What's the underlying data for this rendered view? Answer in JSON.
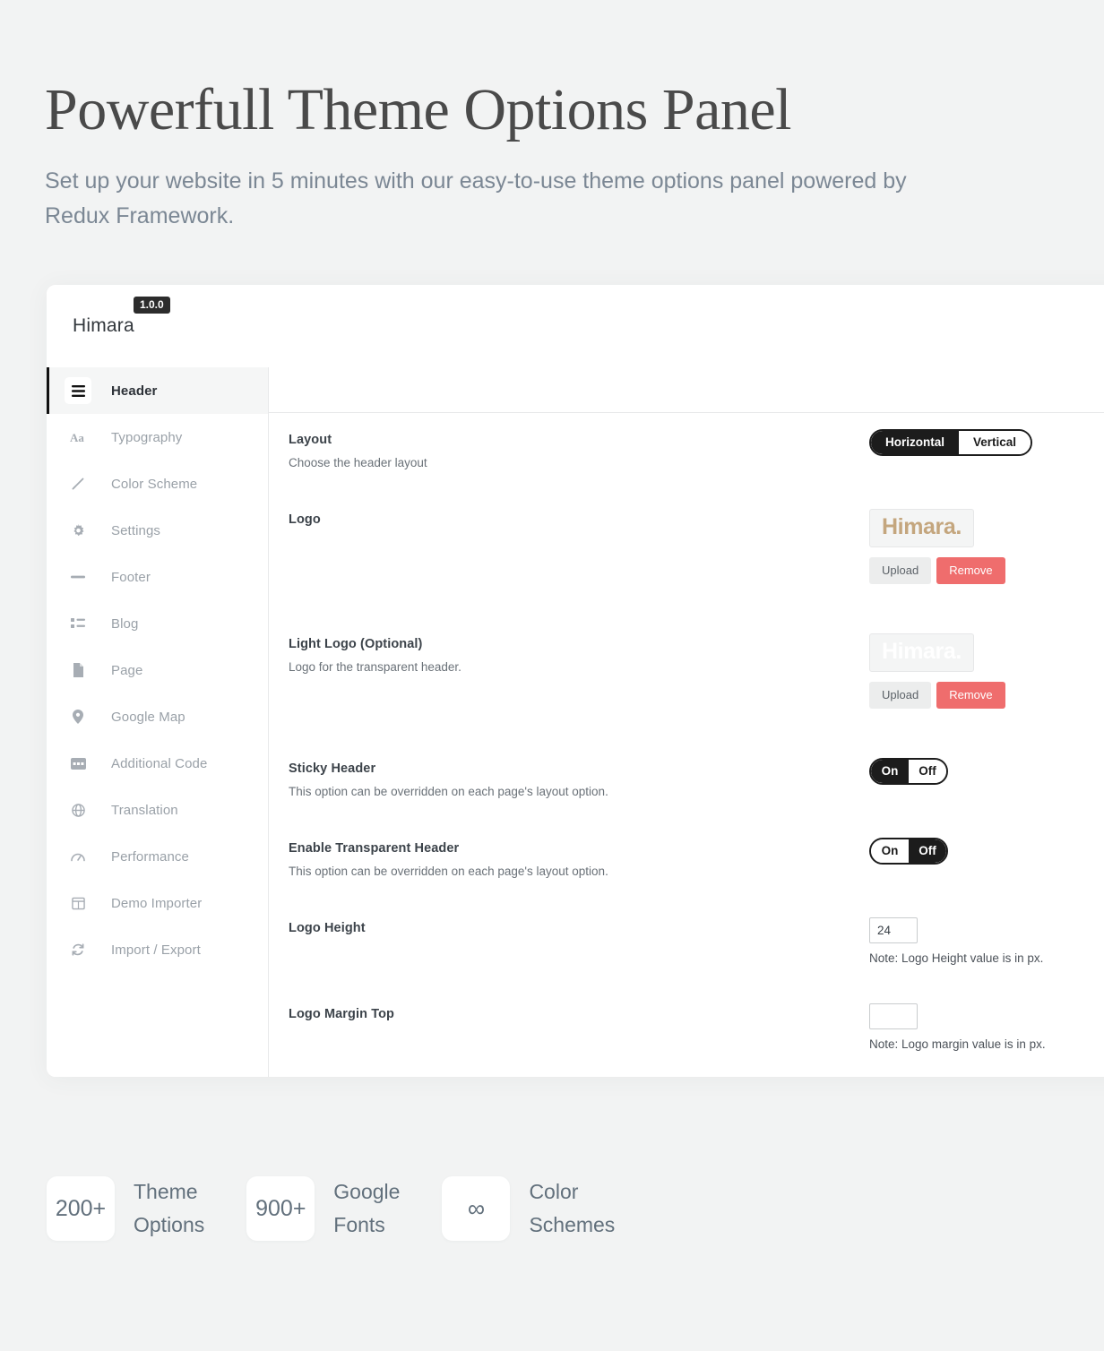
{
  "hero": {
    "title": "Powerfull Theme Options Panel",
    "subtitle": "Set up your website in 5 minutes with our easy-to-use theme options panel powered by Redux Framework."
  },
  "panel": {
    "brand": "Himara",
    "version": "1.0.0"
  },
  "sidebar": {
    "items": [
      {
        "label": "Header",
        "icon": "hamburger-icon",
        "active": true
      },
      {
        "label": "Typography",
        "icon": "text-size-icon",
        "active": false
      },
      {
        "label": "Color Scheme",
        "icon": "brush-icon",
        "active": false
      },
      {
        "label": "Settings",
        "icon": "gear-icon",
        "active": false
      },
      {
        "label": "Footer",
        "icon": "dash-icon",
        "active": false
      },
      {
        "label": "Blog",
        "icon": "list-icon",
        "active": false
      },
      {
        "label": "Page",
        "icon": "file-icon",
        "active": false
      },
      {
        "label": "Google Map",
        "icon": "map-pin-icon",
        "active": false
      },
      {
        "label": "Additional Code",
        "icon": "code-icon",
        "active": false
      },
      {
        "label": "Translation",
        "icon": "globe-icon",
        "active": false
      },
      {
        "label": "Performance",
        "icon": "gauge-icon",
        "active": false
      },
      {
        "label": "Demo Importer",
        "icon": "window-icon",
        "active": false
      },
      {
        "label": "Import / Export",
        "icon": "refresh-icon",
        "active": false
      }
    ]
  },
  "fields": {
    "layout": {
      "label": "Layout",
      "desc": "Choose the header layout",
      "options": [
        "Horizontal",
        "Vertical"
      ],
      "selected": "Horizontal"
    },
    "logo": {
      "label": "Logo",
      "preview_text": "Himara.",
      "preview_color": "#c4a67e",
      "upload_label": "Upload",
      "remove_label": "Remove"
    },
    "light_logo": {
      "label": "Light Logo (Optional)",
      "desc": "Logo for the transparent header.",
      "preview_text": "Himara.",
      "preview_color": "#ffffff",
      "upload_label": "Upload",
      "remove_label": "Remove"
    },
    "sticky_header": {
      "label": "Sticky Header",
      "desc": "This option can be overridden on each page's layout option.",
      "on_label": "On",
      "off_label": "Off",
      "value": "On"
    },
    "transparent_header": {
      "label": "Enable Transparent Header",
      "desc": "This option can be overridden on each page's layout option.",
      "on_label": "On",
      "off_label": "Off",
      "value": "Off"
    },
    "logo_height": {
      "label": "Logo Height",
      "value": "24",
      "placeholder": "",
      "note": "Note: Logo Height value is in px."
    },
    "logo_margin_top": {
      "label": "Logo Margin Top",
      "value": "",
      "placeholder": "",
      "note": "Note: Logo margin value is in px."
    }
  },
  "stats": [
    {
      "value": "200+",
      "label": "Theme\nOptions"
    },
    {
      "value": "900+",
      "label": "Google\nFonts"
    },
    {
      "value": "∞",
      "label": "Color\nSchemes"
    }
  ],
  "colors": {
    "background": "#f2f3f3",
    "accent_dark": "#1c1c1c",
    "danger": "#ef6d6d",
    "logo_tan": "#c4a67e"
  }
}
